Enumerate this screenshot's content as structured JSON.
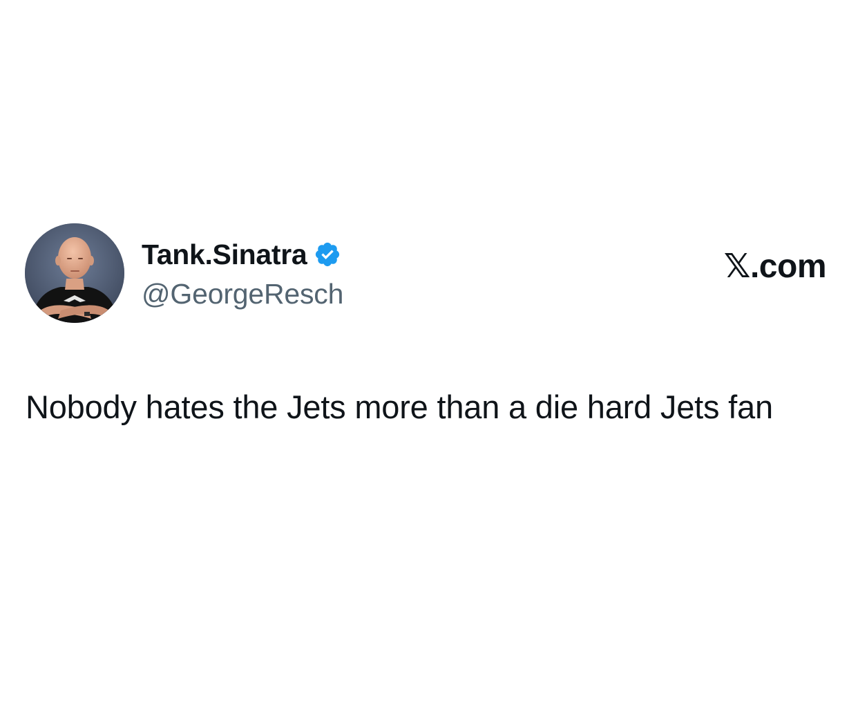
{
  "author": {
    "display_name": "Tank.Sinatra",
    "handle": "@GeorgeResch",
    "verified": true,
    "verified_icon": "verified-badge-icon",
    "verified_color": "#1d9bf0",
    "avatar_icon": "profile-photo"
  },
  "brand": {
    "label": "𝕏.com"
  },
  "tweet": {
    "text": "Nobody hates the Jets more than a die hard Jets fan"
  },
  "colors": {
    "background": "#ffffff",
    "text": "#0f1419",
    "secondary_text": "#536471"
  }
}
